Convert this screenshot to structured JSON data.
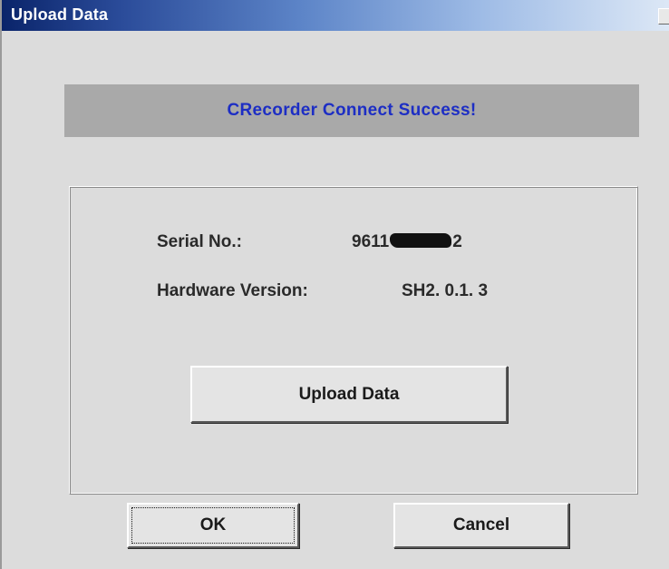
{
  "window": {
    "title": "Upload Data"
  },
  "status": {
    "message": "CRecorder Connect Success!"
  },
  "device": {
    "serial_label": "Serial No.:",
    "serial_value_prefix": "9611",
    "serial_value_suffix": "2",
    "hardware_label": "Hardware Version:",
    "hardware_value": "SH2. 0.1. 3"
  },
  "actions": {
    "upload_label": "Upload Data",
    "ok_label": "OK",
    "cancel_label": "Cancel"
  },
  "colors": {
    "dialog_background": "#dcdcdc",
    "banner_background": "#a9a9a9",
    "banner_text": "#1d2ec4",
    "titlebar_start": "#0a246a",
    "titlebar_end": "#dde8f6"
  }
}
